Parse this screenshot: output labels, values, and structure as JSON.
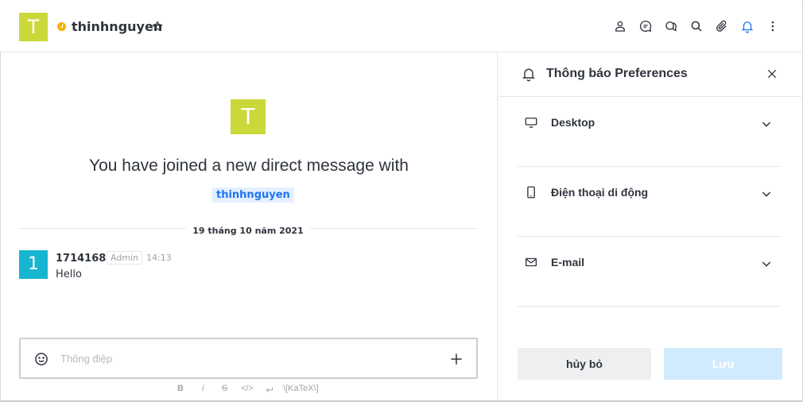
{
  "header": {
    "avatar_letter": "T",
    "room_name": "thinhnguyen",
    "toolbar_icons": [
      "user-info-icon",
      "threads-icon",
      "discussion-icon",
      "search-icon",
      "attachment-icon",
      "notification-bell-icon",
      "kebab-menu-icon"
    ],
    "status_color": "#f5b000",
    "active_color": "#1d74f5"
  },
  "main": {
    "welcome_avatar_letter": "T",
    "welcome_text": "You have joined a new direct message with",
    "mention": "thinhnguyen",
    "date_divider": "19 tháng 10 năm 2021",
    "messages": [
      {
        "avatar_letter": "1",
        "username": "1714168",
        "role": "Admin",
        "time": "14:13",
        "body": "Hello"
      }
    ],
    "composer": {
      "placeholder": "Thông điệp"
    },
    "format_bar": {
      "bold": "B",
      "italic": "i",
      "strike": "S",
      "code": "</>",
      "katex": "\\[KaTeX\\]"
    }
  },
  "panel": {
    "title": "Thông báo Preferences",
    "sections": [
      {
        "label": "Desktop",
        "icon": "monitor-icon"
      },
      {
        "label": "Điện thoại di động",
        "icon": "mobile-icon"
      },
      {
        "label": "E-mail",
        "icon": "mail-icon"
      }
    ],
    "cancel_label": "hủy bỏ",
    "save_label": "Lưu"
  }
}
